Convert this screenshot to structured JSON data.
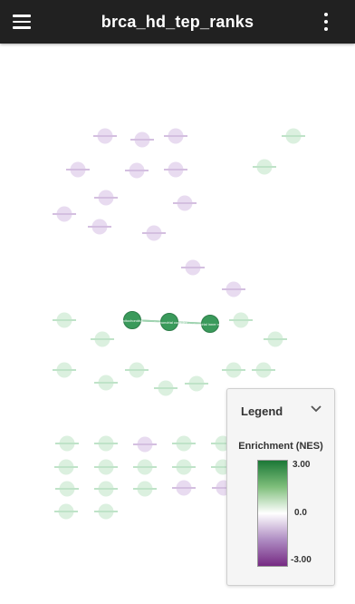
{
  "app": {
    "title": "brca_hd_tep_ranks"
  },
  "icons": {
    "menu": "menu-icon",
    "more": "more-vertical-icon",
    "chevron": "chevron-down-icon"
  },
  "network": {
    "colors": {
      "green_strong": "#3a9a5b",
      "green_light": "#d7eedc",
      "purple_light": "#e6d7ee",
      "edge": "#9fd3b0"
    },
    "highlighted_labels": [
      "mitochondria",
      "mitochondrial complex",
      "mitochondrial inner membrane"
    ]
  },
  "legend": {
    "title": "Legend",
    "label": "Enrichment (NES)",
    "max": "3.00",
    "mid": "0.0",
    "min": "-3.00",
    "colors": {
      "top": "#1b7837",
      "mid": "#ffffff",
      "bottom": "#762a83"
    }
  }
}
